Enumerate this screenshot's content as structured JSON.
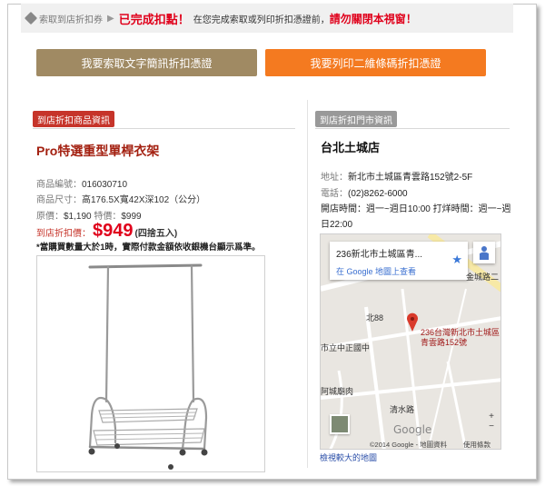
{
  "notice": {
    "crumb": "索取到店折扣券",
    "separator": "▶",
    "done_label": "已完成扣點！",
    "middle_text": "在您完成索取或列印折扣憑證前，",
    "warning": "請勿關閉本視窗！"
  },
  "buttons": {
    "sms": "我要索取文字簡訊折扣憑證",
    "qr": "我要列印二維條碼折扣憑證"
  },
  "product": {
    "section_label": "到店折扣商品資訊",
    "title": "Pro特選重型單桿衣架",
    "code_label": "商品編號：",
    "code": "016030710",
    "size_label": "商品尺寸：",
    "size": "高176.5X寬42X深102（公分）",
    "orig_label": "原價：",
    "orig_price": "$1,190",
    "special_label": "特價：",
    "special_price": "$999",
    "discount_label": "到店折扣價：",
    "discount_price": "$949",
    "rounding": "(四捨五入)",
    "note": "*當購買數量大於1時，實際付款金額依收銀機台顯示爲準。"
  },
  "store": {
    "section_label": "到店折扣門市資訊",
    "name": "台北土城店",
    "address_label": "地址：",
    "address": "新北市土城區青雲路152號2-5F",
    "tel_label": "電話：",
    "tel": "(02)8262-6000",
    "hours": "開店時間：週一~週日10:00 打烊時間：週一~週日22:00"
  },
  "map": {
    "card_address": "236新北市土城區青...",
    "card_link": "在 Google 地圖上查看",
    "pin_label": "236台灣新北市土城區青雲路152號",
    "streets": {
      "jincheng": "金城路二",
      "bei88": "北88",
      "zhongzheng": "市立中正國中",
      "achengde": "阿城廟肉",
      "qingshui": "清水路"
    },
    "google": "Google",
    "copyright": "©2014 Google - 地圖資料",
    "terms": "使用條款",
    "zoom_in": "+",
    "zoom_out": "−",
    "view_larger": "檢視較大的地圖"
  },
  "colors": {
    "red": "#e0001b",
    "gold_button": "#a08a63",
    "orange_button": "#f47a20",
    "section_red": "#c6342a",
    "section_gray": "#999999"
  }
}
